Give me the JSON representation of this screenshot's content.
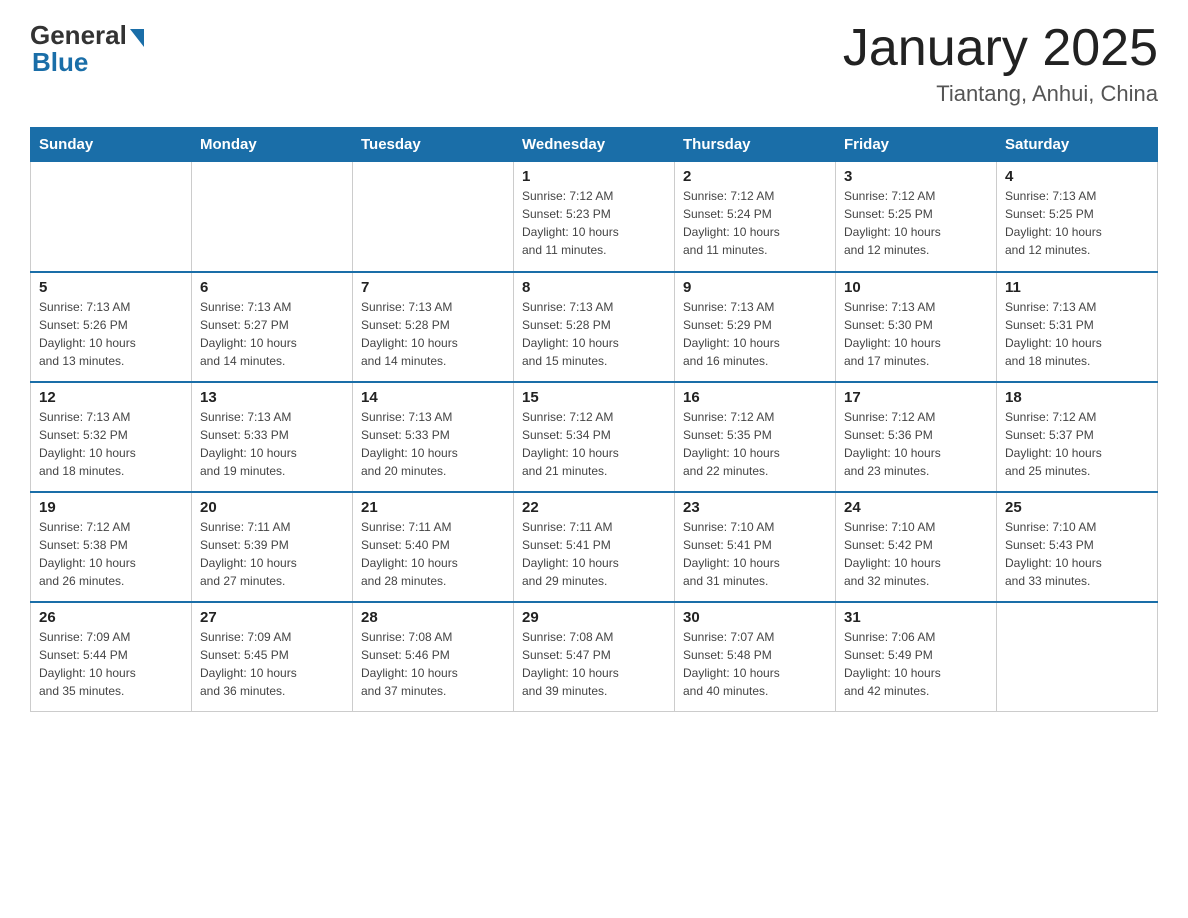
{
  "header": {
    "logo_general": "General",
    "logo_blue": "Blue",
    "title": "January 2025",
    "subtitle": "Tiantang, Anhui, China"
  },
  "weekdays": [
    "Sunday",
    "Monday",
    "Tuesday",
    "Wednesday",
    "Thursday",
    "Friday",
    "Saturday"
  ],
  "weeks": [
    [
      {
        "day": "",
        "info": ""
      },
      {
        "day": "",
        "info": ""
      },
      {
        "day": "",
        "info": ""
      },
      {
        "day": "1",
        "info": "Sunrise: 7:12 AM\nSunset: 5:23 PM\nDaylight: 10 hours\nand 11 minutes."
      },
      {
        "day": "2",
        "info": "Sunrise: 7:12 AM\nSunset: 5:24 PM\nDaylight: 10 hours\nand 11 minutes."
      },
      {
        "day": "3",
        "info": "Sunrise: 7:12 AM\nSunset: 5:25 PM\nDaylight: 10 hours\nand 12 minutes."
      },
      {
        "day": "4",
        "info": "Sunrise: 7:13 AM\nSunset: 5:25 PM\nDaylight: 10 hours\nand 12 minutes."
      }
    ],
    [
      {
        "day": "5",
        "info": "Sunrise: 7:13 AM\nSunset: 5:26 PM\nDaylight: 10 hours\nand 13 minutes."
      },
      {
        "day": "6",
        "info": "Sunrise: 7:13 AM\nSunset: 5:27 PM\nDaylight: 10 hours\nand 14 minutes."
      },
      {
        "day": "7",
        "info": "Sunrise: 7:13 AM\nSunset: 5:28 PM\nDaylight: 10 hours\nand 14 minutes."
      },
      {
        "day": "8",
        "info": "Sunrise: 7:13 AM\nSunset: 5:28 PM\nDaylight: 10 hours\nand 15 minutes."
      },
      {
        "day": "9",
        "info": "Sunrise: 7:13 AM\nSunset: 5:29 PM\nDaylight: 10 hours\nand 16 minutes."
      },
      {
        "day": "10",
        "info": "Sunrise: 7:13 AM\nSunset: 5:30 PM\nDaylight: 10 hours\nand 17 minutes."
      },
      {
        "day": "11",
        "info": "Sunrise: 7:13 AM\nSunset: 5:31 PM\nDaylight: 10 hours\nand 18 minutes."
      }
    ],
    [
      {
        "day": "12",
        "info": "Sunrise: 7:13 AM\nSunset: 5:32 PM\nDaylight: 10 hours\nand 18 minutes."
      },
      {
        "day": "13",
        "info": "Sunrise: 7:13 AM\nSunset: 5:33 PM\nDaylight: 10 hours\nand 19 minutes."
      },
      {
        "day": "14",
        "info": "Sunrise: 7:13 AM\nSunset: 5:33 PM\nDaylight: 10 hours\nand 20 minutes."
      },
      {
        "day": "15",
        "info": "Sunrise: 7:12 AM\nSunset: 5:34 PM\nDaylight: 10 hours\nand 21 minutes."
      },
      {
        "day": "16",
        "info": "Sunrise: 7:12 AM\nSunset: 5:35 PM\nDaylight: 10 hours\nand 22 minutes."
      },
      {
        "day": "17",
        "info": "Sunrise: 7:12 AM\nSunset: 5:36 PM\nDaylight: 10 hours\nand 23 minutes."
      },
      {
        "day": "18",
        "info": "Sunrise: 7:12 AM\nSunset: 5:37 PM\nDaylight: 10 hours\nand 25 minutes."
      }
    ],
    [
      {
        "day": "19",
        "info": "Sunrise: 7:12 AM\nSunset: 5:38 PM\nDaylight: 10 hours\nand 26 minutes."
      },
      {
        "day": "20",
        "info": "Sunrise: 7:11 AM\nSunset: 5:39 PM\nDaylight: 10 hours\nand 27 minutes."
      },
      {
        "day": "21",
        "info": "Sunrise: 7:11 AM\nSunset: 5:40 PM\nDaylight: 10 hours\nand 28 minutes."
      },
      {
        "day": "22",
        "info": "Sunrise: 7:11 AM\nSunset: 5:41 PM\nDaylight: 10 hours\nand 29 minutes."
      },
      {
        "day": "23",
        "info": "Sunrise: 7:10 AM\nSunset: 5:41 PM\nDaylight: 10 hours\nand 31 minutes."
      },
      {
        "day": "24",
        "info": "Sunrise: 7:10 AM\nSunset: 5:42 PM\nDaylight: 10 hours\nand 32 minutes."
      },
      {
        "day": "25",
        "info": "Sunrise: 7:10 AM\nSunset: 5:43 PM\nDaylight: 10 hours\nand 33 minutes."
      }
    ],
    [
      {
        "day": "26",
        "info": "Sunrise: 7:09 AM\nSunset: 5:44 PM\nDaylight: 10 hours\nand 35 minutes."
      },
      {
        "day": "27",
        "info": "Sunrise: 7:09 AM\nSunset: 5:45 PM\nDaylight: 10 hours\nand 36 minutes."
      },
      {
        "day": "28",
        "info": "Sunrise: 7:08 AM\nSunset: 5:46 PM\nDaylight: 10 hours\nand 37 minutes."
      },
      {
        "day": "29",
        "info": "Sunrise: 7:08 AM\nSunset: 5:47 PM\nDaylight: 10 hours\nand 39 minutes."
      },
      {
        "day": "30",
        "info": "Sunrise: 7:07 AM\nSunset: 5:48 PM\nDaylight: 10 hours\nand 40 minutes."
      },
      {
        "day": "31",
        "info": "Sunrise: 7:06 AM\nSunset: 5:49 PM\nDaylight: 10 hours\nand 42 minutes."
      },
      {
        "day": "",
        "info": ""
      }
    ]
  ]
}
